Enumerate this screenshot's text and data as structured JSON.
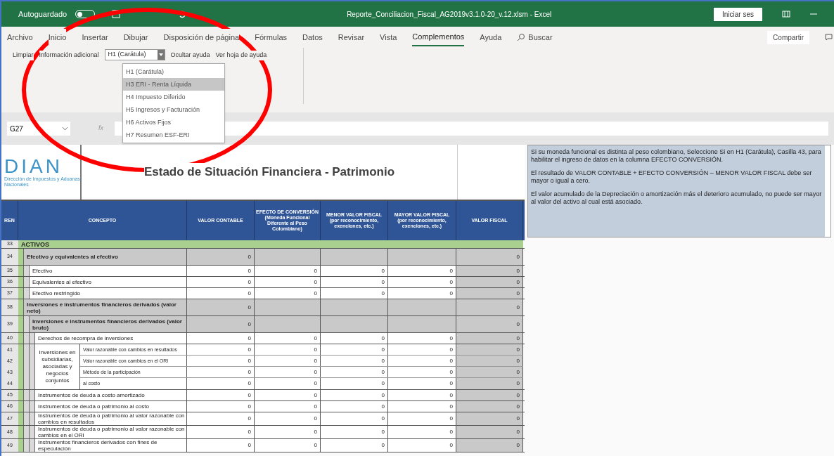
{
  "title_bar": {
    "autosave_label": "Autoguardado",
    "autosave_on": false,
    "title": "Reporte_Conciliacion_Fiscal_AG2019v3.1.0-20_v.12.xlsm  -  Excel",
    "signin": "Iniciar ses"
  },
  "ribbon": {
    "tabs": [
      {
        "label": "Archivo",
        "selected": false
      },
      {
        "label": "Inicio",
        "selected": false
      },
      {
        "label": "Insertar",
        "selected": false
      },
      {
        "label": "Dibujar",
        "selected": false
      },
      {
        "label": "Disposición de página",
        "selected": false
      },
      {
        "label": "Fórmulas",
        "selected": false
      },
      {
        "label": "Datos",
        "selected": false
      },
      {
        "label": "Revisar",
        "selected": false
      },
      {
        "label": "Vista",
        "selected": false
      },
      {
        "label": "Complementos",
        "selected": true
      },
      {
        "label": "Ayuda",
        "selected": false
      }
    ],
    "search": "Buscar",
    "share": "Compartir",
    "commands": {
      "clear": "Limpiar",
      "info": "Información adicional",
      "combo_value": "H1 (Carátula)",
      "hide_help": "Ocultar ayuda",
      "view_help": "Ver hoja de ayuda"
    },
    "dropdown": [
      {
        "label": "H1 (Carátula)",
        "selected": false
      },
      {
        "label": "H3 ERI - Renta Líquida",
        "selected": true
      },
      {
        "label": "H4 Impuesto Diferido",
        "selected": false
      },
      {
        "label": "H5 Ingresos y Facturación",
        "selected": false
      },
      {
        "label": "H6 Activos Fijos",
        "selected": false
      },
      {
        "label": "H7 Resumen ESF-ERI",
        "selected": false
      }
    ]
  },
  "formula_bar": {
    "name_box": "G27",
    "fx": "fx"
  },
  "sheet": {
    "logo": "DIAN",
    "logo_tagline": "Dirección de Impuestos y Aduanas Nacionales",
    "title": "Estado de Situación Financiera - Patrimonio",
    "columns": [
      "REN",
      "CONCEPTO",
      "VALOR CONTABLE",
      "EFECTO DE CONVERSIÓN (Moneda Funcional Diferente al Peso Colombiano)",
      "MENOR VALOR FISCAL (por reconocimiento, exenciones, etc.)",
      "MAYOR VALOR FISCAL (por reconocimiento, exenciones, etc.)",
      "VALOR FISCAL"
    ],
    "rows": [
      {
        "kind": "section",
        "num": "33",
        "label": "ACTIVOS",
        "children": [
          {
            "kind": "group",
            "num": "34",
            "label": "Efectivo y equivalentes al efectivo",
            "valor_contable": "0",
            "valor_fiscal": "0",
            "children": [
              {
                "kind": "item",
                "num": "35",
                "label": "Efectivo",
                "values": [
                  "0",
                  "0",
                  "0",
                  "0",
                  "0"
                ]
              },
              {
                "kind": "item",
                "num": "36",
                "label": "Equivalentes al efectivo",
                "values": [
                  "0",
                  "0",
                  "0",
                  "0",
                  "0"
                ]
              },
              {
                "kind": "item",
                "num": "37",
                "label": "Efectivo restringido",
                "values": [
                  "0",
                  "0",
                  "0",
                  "0",
                  "0"
                ]
              }
            ]
          },
          {
            "kind": "group",
            "num": "38",
            "label": "Inversiones e instrumentos financieros derivados (valor neto)",
            "valor_contable": "0",
            "valor_fiscal": "0",
            "children": [
              {
                "kind": "group",
                "num": "39",
                "label": "Inversiones e instrumentos financieros derivados (valor bruto)",
                "valor_contable": "0",
                "valor_fiscal": "0",
                "children": [
                  {
                    "kind": "item",
                    "num": "40",
                    "label": "Derechos de recompra de inversiones",
                    "values": [
                      "0",
                      "0",
                      "0",
                      "0",
                      "0"
                    ]
                  },
                  {
                    "kind": "merged",
                    "label": "Inversiones en subsidiarias, asociadas y negocios conjuntos",
                    "children": [
                      {
                        "num": "41",
                        "label": "Valor razonable con cambios en resultados",
                        "values": [
                          "0",
                          "0",
                          "0",
                          "0",
                          "0"
                        ]
                      },
                      {
                        "num": "42",
                        "label": "Valor razonable con cambios en el ORI",
                        "values": [
                          "0",
                          "0",
                          "0",
                          "0",
                          "0"
                        ]
                      },
                      {
                        "num": "43",
                        "label": "Método de la participación",
                        "values": [
                          "0",
                          "0",
                          "0",
                          "0",
                          "0"
                        ]
                      },
                      {
                        "num": "44",
                        "label": "al costo",
                        "values": [
                          "0",
                          "0",
                          "0",
                          "0",
                          "0"
                        ]
                      }
                    ]
                  },
                  {
                    "kind": "item",
                    "num": "45",
                    "label": "Instrumentos de deuda a costo amortizado",
                    "values": [
                      "0",
                      "0",
                      "0",
                      "0",
                      "0"
                    ]
                  },
                  {
                    "kind": "item",
                    "num": "46",
                    "label": "Instrumentos de deuda o patrimonio al costo",
                    "values": [
                      "0",
                      "0",
                      "0",
                      "0",
                      "0"
                    ]
                  },
                  {
                    "kind": "item",
                    "num": "47",
                    "label": "Instrumentos de deuda o patrimonio al valor razonable con cambios en resultados",
                    "values": [
                      "0",
                      "0",
                      "0",
                      "0",
                      "0"
                    ]
                  },
                  {
                    "kind": "item",
                    "num": "48",
                    "label": "Instrumentos de deuda o patrimonio al valor razonable con cambios en el ORI",
                    "values": [
                      "0",
                      "0",
                      "0",
                      "0",
                      "0"
                    ]
                  },
                  {
                    "kind": "item",
                    "num": "49",
                    "label": "Instrumentos financieros derivados con fines de especulación",
                    "values": [
                      "0",
                      "0",
                      "0",
                      "0",
                      "0"
                    ]
                  }
                ]
              }
            ]
          }
        ]
      }
    ]
  },
  "help_note": [
    "Si su moneda funcional es distinta al peso colombiano, Seleccione Si en H1 (Carátula), Casilla 43, para habilitar el ingreso de datos en la columna EFECTO CONVERSIÓN.",
    "El resultado de VALOR CONTABLE + EFECTO CONVERSIÓN – MENOR VALOR FISCAL debe ser mayor o igual a cero.",
    "El valor acumulado de la Depreciación o amortización más el deterioro acumulado, no puede ser mayor al valor del activo al cual está asociado."
  ]
}
